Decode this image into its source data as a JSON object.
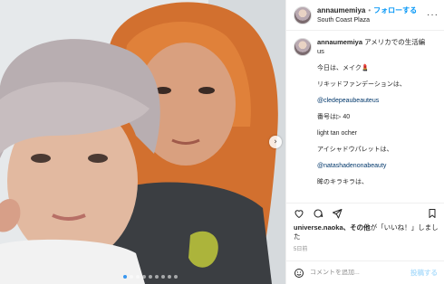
{
  "post": {
    "username": "annaumemiya",
    "follow_label": "フォローする",
    "separator": "•",
    "location": "South Coast Plaza",
    "more_icon": "more-horizontal-icon",
    "caption": {
      "username": "annaumemiya",
      "first_line": "アメリカでの生活編",
      "first_line_cont": "us",
      "lines": [
        "今日は、メイク💄",
        "リキッドファンデーションは、",
        "@cledepeaubeauteus",
        "番号は▷ 40",
        "light tan ocher",
        "アイシャドウパレットは、",
        "@natashadenonabeauty",
        "眸のキラキラは、"
      ]
    },
    "likes": {
      "liker": "universe.naoka",
      "text": "、その他",
      "suffix": "が「いいね！」しました"
    },
    "date": "5日前",
    "comment_placeholder": "コメントを追加...",
    "post_label": "投稿する"
  },
  "carousel": {
    "slide_count": 9,
    "active_index": 0,
    "next_icon": "chevron-right-icon",
    "next_glyph": "›"
  },
  "colors": {
    "accent": "#0095f6",
    "text": "#262626",
    "muted": "#8e8e8e",
    "post_disabled": "#b2dffc"
  }
}
